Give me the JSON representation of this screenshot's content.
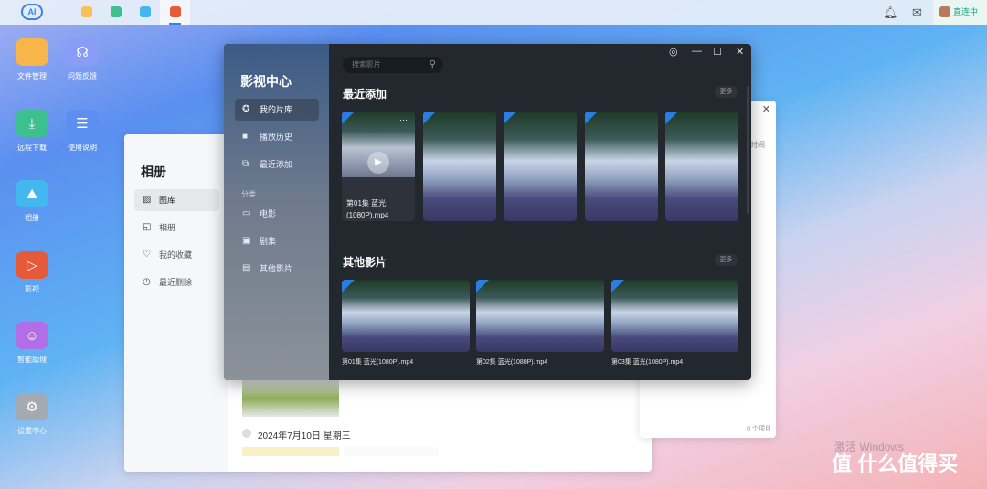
{
  "topbar": {
    "logo": "AI",
    "status": "直连中"
  },
  "desktop": [
    {
      "label": "文件管理",
      "color": "#f8b54a"
    },
    {
      "label": "问题反馈",
      "color": "#8a9cf5"
    },
    {
      "label": "远程下载",
      "color": "#3dbf8f"
    },
    {
      "label": "使用说明",
      "color": "#5b8ff0"
    },
    {
      "label": "相册",
      "color": "#43b7ee"
    },
    {
      "label": "影视",
      "color": "#e65a3a"
    },
    {
      "label": "智能助理",
      "color": "#b16ee6"
    },
    {
      "label": "设置中心",
      "color": "#a5a9b2"
    }
  ],
  "photos": {
    "title": "相册",
    "items": [
      "图库",
      "相册",
      "我的收藏",
      "最近删除"
    ],
    "date": "2024年7月10日 星期三"
  },
  "third": {
    "col": "时间",
    "count": "0 个项目"
  },
  "video": {
    "title": "影视中心",
    "nav": [
      "我的片库",
      "播放历史",
      "最近添加"
    ],
    "category": "分类",
    "cats": [
      "电影",
      "剧集",
      "其他影片"
    ],
    "search_placeholder": "搜索影片",
    "recent_title": "最近添加",
    "other_title": "其他影片",
    "more": "更多",
    "recent_first": "第01集 蓝光(1080P).mp4",
    "others": [
      "第01集 蓝光(1080P).mp4",
      "第02集 蓝光(1080P).mp4",
      "第03集 蓝光(1080P).mp4"
    ]
  },
  "watermark": {
    "line1": "激活 Windows",
    "brand": "值 什么值得买"
  }
}
